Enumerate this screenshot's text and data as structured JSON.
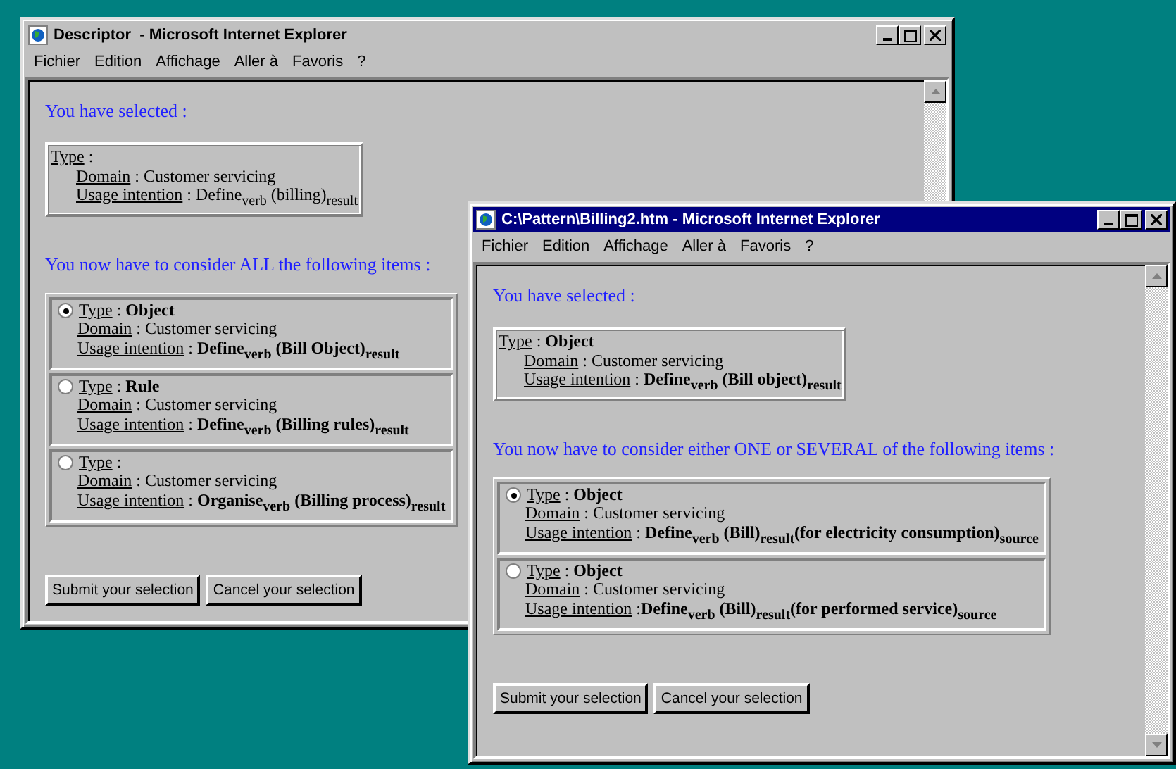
{
  "windows": [
    {
      "title": "Descriptor  - Microsoft Internet Explorer",
      "active": false,
      "menu": [
        "Fichier",
        "Edition",
        "Affichage",
        "Aller à",
        "Favoris",
        "?"
      ],
      "selected_heading": "You have selected :",
      "selected": {
        "lines": [
          {
            "label": "Type",
            "value": " :"
          },
          {
            "label": "Domain",
            "value": " : Customer servicing"
          },
          {
            "label": "Usage intention",
            "value": " : Define$_{verb}$ (billing)$_{result}$"
          }
        ]
      },
      "consider_heading": "You now have to consider ALL the following items :",
      "items": [
        {
          "selected": true,
          "lines": [
            {
              "label": "Type",
              "value": " : ",
              "strong": "Object"
            },
            {
              "label": "Domain",
              "value": " : Customer servicing"
            },
            {
              "label": "Usage intention",
              "value": " : ",
              "strong": "Define$_{verb}$ (Bill Object)$_{result}$"
            }
          ]
        },
        {
          "selected": false,
          "lines": [
            {
              "label": "Type",
              "value": " : ",
              "strong": "Rule"
            },
            {
              "label": "Domain",
              "value": " : Customer servicing"
            },
            {
              "label": "Usage intention",
              "value": " : ",
              "strong": "Define$_{verb}$ (Billing rules)$_{result}$"
            }
          ]
        },
        {
          "selected": false,
          "lines": [
            {
              "label": "Type",
              "value": " :"
            },
            {
              "label": "Domain",
              "value": " : Customer servicing"
            },
            {
              "label": "Usage intention",
              "value": " : ",
              "strong": "Organise$_{verb}$ (Billing process)$_{result}$"
            }
          ]
        }
      ],
      "buttons": [
        "Submit your selection",
        "Cancel your selection"
      ]
    },
    {
      "title": "C:\\Pattern\\Billing2.htm - Microsoft Internet Explorer",
      "active": true,
      "menu": [
        "Fichier",
        "Edition",
        "Affichage",
        "Aller à",
        "Favoris",
        "?"
      ],
      "selected_heading": "You have selected :",
      "selected": {
        "lines": [
          {
            "label": "Type",
            "value": " : ",
            "strong": "Object"
          },
          {
            "label": "Domain",
            "value": " : Customer servicing"
          },
          {
            "label": "Usage intention",
            "value": " : ",
            "strong": "Define$_{verb}$ (Bill object)$_{result}$"
          }
        ]
      },
      "consider_heading": "You now have to consider either ONE or SEVERAL of the following items :",
      "items": [
        {
          "selected": true,
          "lines": [
            {
              "label": "Type",
              "value": " : ",
              "strong": "Object"
            },
            {
              "label": "Domain",
              "value": " : Customer servicing"
            },
            {
              "label": "Usage intention",
              "value": " : ",
              "strong": "Define$_{verb}$ (Bill)$_{result}$(for electricity consumption)$_{source}$"
            }
          ]
        },
        {
          "selected": false,
          "lines": [
            {
              "label": "Type",
              "value": " : ",
              "strong": "Object"
            },
            {
              "label": "Domain",
              "value": " : Customer servicing"
            },
            {
              "label": "Usage intention",
              "value": " :",
              "strong": "Define$_{verb}$ (Bill)$_{result}$(for performed service)$_{source}$"
            }
          ]
        }
      ],
      "buttons": [
        "Submit your selection",
        "Cancel your selection"
      ]
    }
  ]
}
